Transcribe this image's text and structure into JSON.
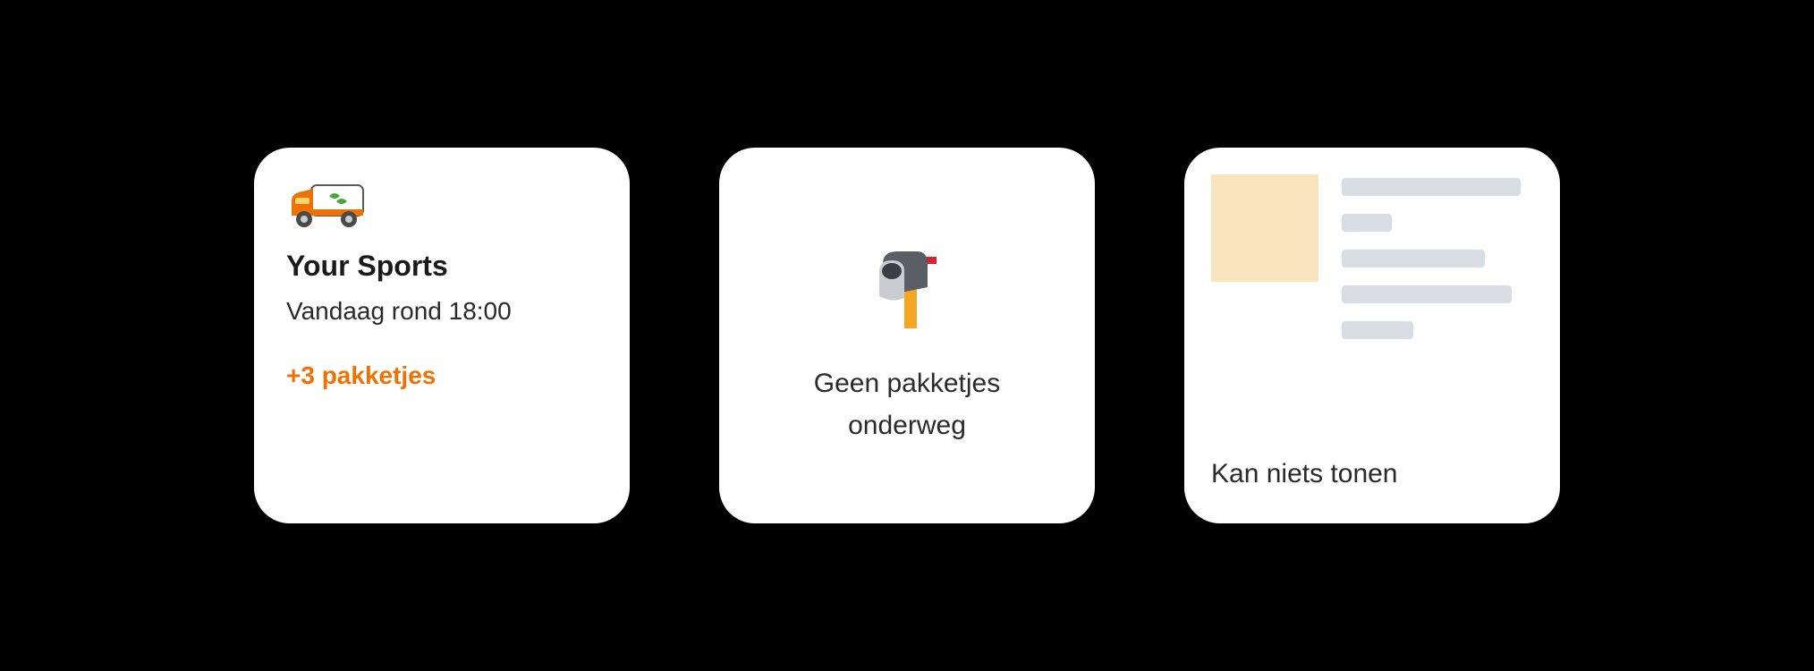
{
  "card1": {
    "sender_name": "Your Sports",
    "delivery_time": "Vandaag rond 18:00",
    "more_packages": "+3 pakketjes"
  },
  "card2": {
    "no_packages_line1": "Geen pakketjes",
    "no_packages_line2": "onderweg"
  },
  "card3": {
    "cannot_show": "Kan niets tonen"
  },
  "icons": {
    "van": "delivery-van-icon",
    "mailbox": "mailbox-icon"
  },
  "colors": {
    "accent_orange": "#ee7203",
    "card_bg": "#ffffff",
    "page_bg": "#000000",
    "skeleton_square": "#fae4bd",
    "skeleton_line": "#d7dde3"
  }
}
